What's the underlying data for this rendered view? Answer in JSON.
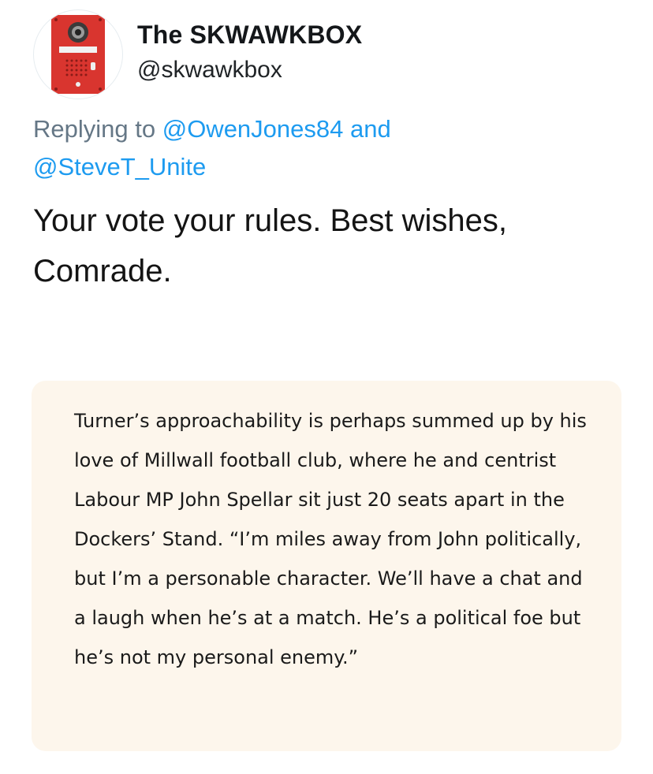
{
  "account": {
    "display_name": "The SKWAWKBOX",
    "handle": "@skwawkbox",
    "avatar_icon": "red-intercom-speaker-icon",
    "avatar_label": "THE SKWAWKBOX"
  },
  "reply_context": {
    "prefix": "Replying to ",
    "mention_1": "@OwenJones84",
    "joiner": " and",
    "mention_2": "@SteveT_Unite"
  },
  "tweet_text": "Your vote your rules. Best wishes, Comrade.",
  "quote_image": {
    "text": "Turner’s approachability is perhaps summed up by his love of Millwall football club, where he and centrist Labour MP John Spellar sit just 20 seats apart in the Dockers’ Stand. “I’m miles away from John politically, but I’m a personable character. We’ll have a chat and a laugh when he’s at a match. He’s a political foe but he’s not my personal enemy.”"
  },
  "colors": {
    "link": "#1d9bf0",
    "muted": "#657786",
    "quote_background": "#fdf6ec",
    "avatar_red": "#d9352f"
  }
}
